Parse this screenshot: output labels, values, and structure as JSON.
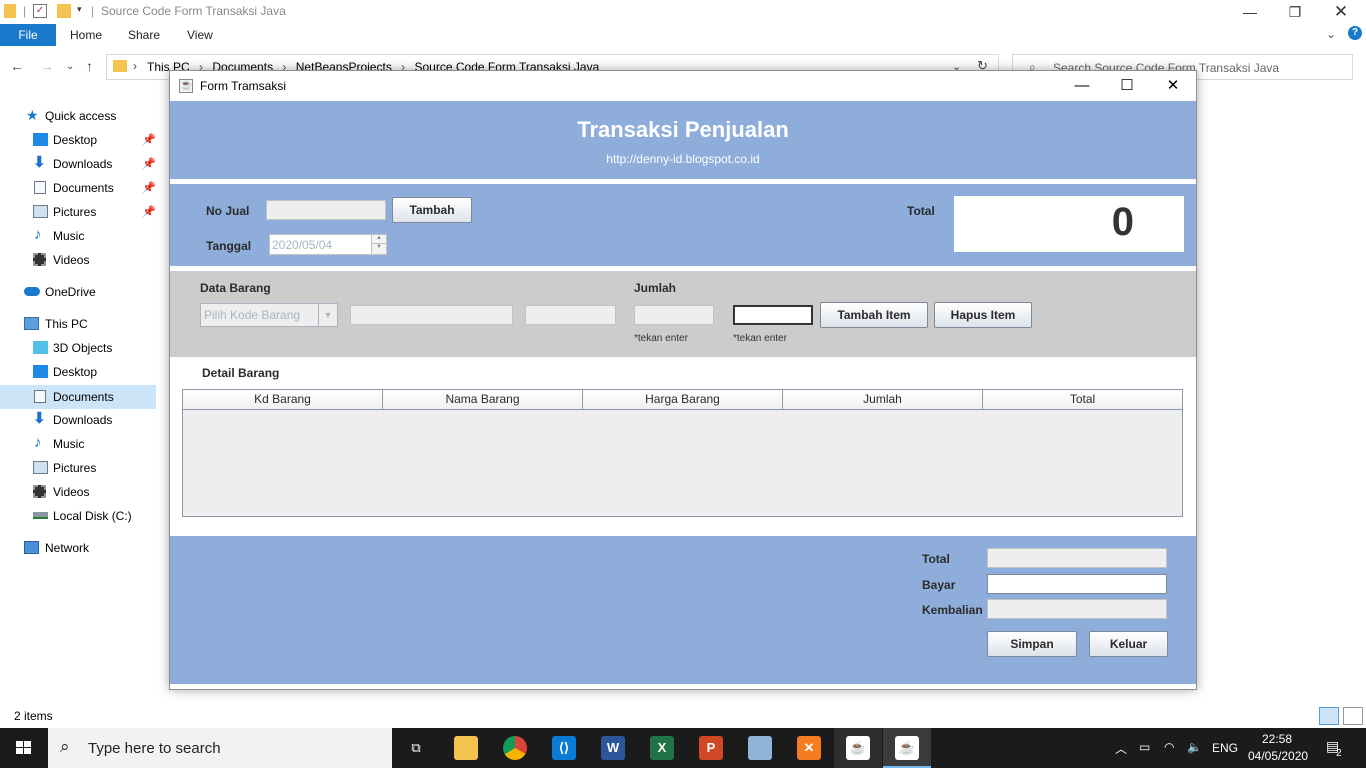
{
  "explorer": {
    "window_title": "Source Code Form Transaksi Java",
    "ribbon_tabs": [
      "File",
      "Home",
      "Share",
      "View"
    ],
    "breadcrumb": [
      "This PC",
      "Documents",
      "NetBeansProjects",
      "Source Code Form Transaksi Java"
    ],
    "search_placeholder": "Search Source Code Form Transaksi Java",
    "nav": {
      "quick_access": "Quick access",
      "quick_items": [
        "Desktop",
        "Downloads",
        "Documents",
        "Pictures",
        "Music",
        "Videos"
      ],
      "onedrive": "OneDrive",
      "this_pc": "This PC",
      "pc_items": [
        "3D Objects",
        "Desktop",
        "Documents",
        "Downloads",
        "Music",
        "Pictures",
        "Videos",
        "Local Disk (C:)"
      ],
      "network": "Network"
    },
    "status": "2 items"
  },
  "taskbar": {
    "search_placeholder": "Type here to search",
    "language": "ENG",
    "time": "22:58",
    "date": "04/05/2020",
    "notification_count": "2"
  },
  "form": {
    "window_title": "Form Tramsaksi",
    "heading": "Transaksi Penjualan",
    "url": "http://denny-id.blogspot.co.id",
    "no_jual_label": "No Jual",
    "no_jual_value": "",
    "tambah_button": "Tambah",
    "tanggal_label": "Tanggal",
    "tanggal_value": "2020/05/04",
    "total_label": "Total",
    "total_value": "0",
    "data_barang_label": "Data Barang",
    "kode_barang_placeholder": "Pilih Kode Barang",
    "jumlah_label": "Jumlah",
    "tekan_enter_1": "*tekan enter",
    "tekan_enter_2": "*tekan enter",
    "tambah_item_button": "Tambah Item",
    "hapus_item_button": "Hapus Item",
    "detail_barang_label": "Detail Barang",
    "table_columns": [
      "Kd Barang",
      "Nama Barang",
      "Harga Barang",
      "Jumlah",
      "Total"
    ],
    "bottom_total_label": "Total",
    "bayar_label": "Bayar",
    "kembalian_label": "Kembalian",
    "simpan_button": "Simpan",
    "keluar_button": "Keluar"
  }
}
